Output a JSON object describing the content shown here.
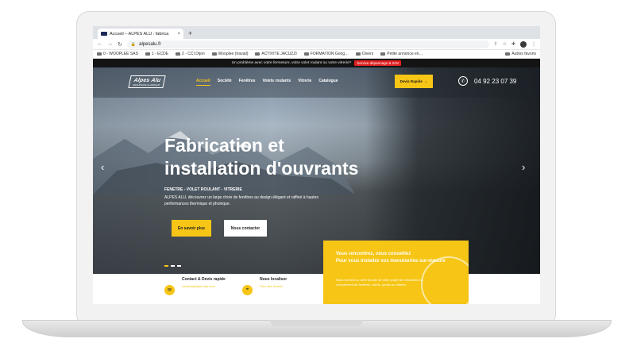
{
  "browser": {
    "tab_title": "Accueil – ALPES ALU : fabrica",
    "tab_close": "×",
    "new_tab": "+",
    "url": "alpesalu.fr",
    "bookmarks": [
      "0 - WOOPLEE SAS",
      "1 - ECDE",
      "2 - CCI Dijon",
      "Wooplee (travail)",
      "ACTIVITE JACUZZI",
      "FORMATION Goog…",
      "Divers",
      "Petite annonce en…"
    ],
    "bookmarks_other": "Autres favoris"
  },
  "site": {
    "announce_text": "Un problème avec votre fermeture, votre volet roulant ou votre vitrerie?",
    "announce_button": "Service dépannage & SAV",
    "logo_main": "Alpes Alu",
    "logo_sub": "MENUISERIE ALUMINIUM",
    "menu": [
      "Accueil",
      "Société",
      "Fenêtres",
      "Volets roulants",
      "Vitrerie",
      "Catalogue"
    ],
    "devis_button": "Devis Rapide",
    "phone": "04 92 23 07 39",
    "headline_line1": "Fabrication et",
    "headline_line2": "installation d'ouvrants",
    "subtitle": "FENETRE - VOLET ROULANT - VITRERIE",
    "description": "ALPES ALU, découvrez un large choix de fenêtres au design élégant et raffiné à hautes performances thermique et phonique.",
    "btn_more": "En savoir plus",
    "btn_contact": "Nous contacter",
    "features": [
      {
        "title": "Contact & Devis rapide",
        "sub": "contact@alpes-alu.com"
      },
      {
        "title": "Nous localiser",
        "sub": "Parc des Serres"
      }
    ],
    "yellow_title": "Vous rencontrez, vous conseillez\nPour vous installez vos menuiseries sur-mesure",
    "yellow_text": "Nous sommes à votre écoute de votre projet de rénovation ou complément de fenêtres, volets, portes ou vitrerie."
  },
  "colors": {
    "accent": "#f6c516",
    "alert": "#e02020"
  }
}
